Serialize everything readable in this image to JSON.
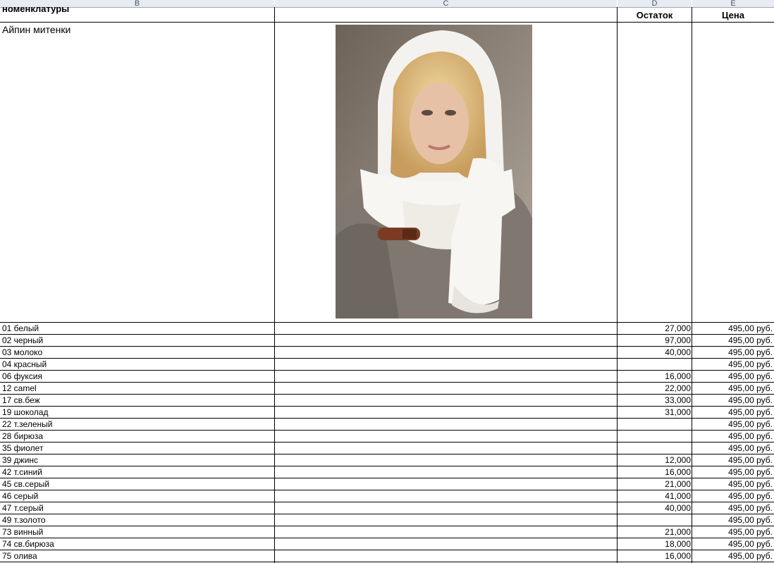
{
  "columns": {
    "b": "B",
    "c": "C",
    "d": "D",
    "e": "E"
  },
  "header": {
    "name_cut": "номенклатуры",
    "stock": "Остаток",
    "price": "Цена"
  },
  "product": {
    "name": "Айпин митенки",
    "photo_icon": "product-photo-woman-white-hood-mittens"
  },
  "rows": [
    {
      "color": "01 белый",
      "stock": "27,000",
      "price": "495,00 руб."
    },
    {
      "color": "02 черный",
      "stock": "97,000",
      "price": "495,00 руб."
    },
    {
      "color": "03 молоко",
      "stock": "40,000",
      "price": "495,00 руб."
    },
    {
      "color": "04 красный",
      "stock": "",
      "price": "495,00 руб."
    },
    {
      "color": "06 фуксия",
      "stock": "16,000",
      "price": "495,00 руб."
    },
    {
      "color": "12 camel",
      "stock": "22,000",
      "price": "495,00 руб."
    },
    {
      "color": "17 св.беж",
      "stock": "33,000",
      "price": "495,00 руб."
    },
    {
      "color": "19 шоколад",
      "stock": "31,000",
      "price": "495,00 руб."
    },
    {
      "color": "22 т.зеленый",
      "stock": "",
      "price": "495,00 руб."
    },
    {
      "color": "28 бирюза",
      "stock": "",
      "price": "495,00 руб."
    },
    {
      "color": "35 фиолет",
      "stock": "",
      "price": "495,00 руб."
    },
    {
      "color": "39 джинс",
      "stock": "12,000",
      "price": "495,00 руб."
    },
    {
      "color": "42 т.синий",
      "stock": "16,000",
      "price": "495,00 руб."
    },
    {
      "color": "45 св.серый",
      "stock": "21,000",
      "price": "495,00 руб."
    },
    {
      "color": "46 серый",
      "stock": "41,000",
      "price": "495,00 руб."
    },
    {
      "color": "47 т.серый",
      "stock": "40,000",
      "price": "495,00 руб."
    },
    {
      "color": "49 т.золото",
      "stock": "",
      "price": "495,00 руб."
    },
    {
      "color": "73 винный",
      "stock": "21,000",
      "price": "495,00 руб."
    },
    {
      "color": "74 св.бирюза",
      "stock": "18,000",
      "price": "495,00 руб."
    },
    {
      "color": "75 олива",
      "stock": "16,000",
      "price": "495,00 руб."
    }
  ]
}
